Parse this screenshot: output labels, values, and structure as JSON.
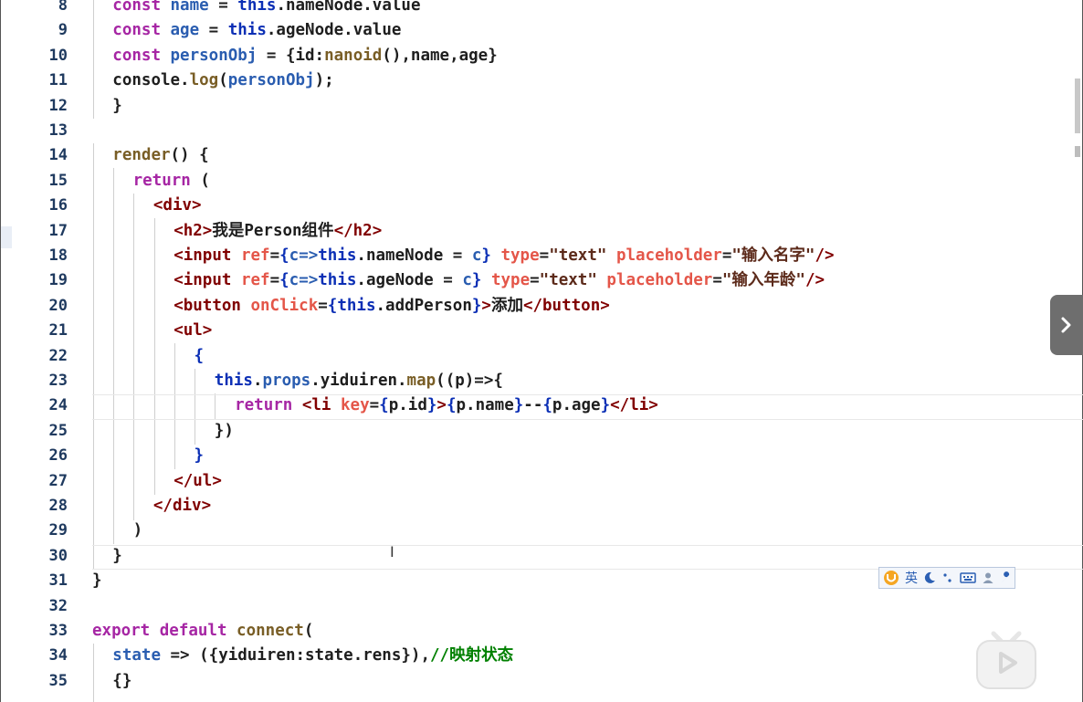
{
  "editor": {
    "lines": [
      {
        "num": "8",
        "tokens": [
          {
            "t": "const ",
            "c": "t-kw"
          },
          {
            "t": "name",
            "c": "t-var"
          },
          {
            "t": " = ",
            "c": "t-plain"
          },
          {
            "t": "this",
            "c": "t-this"
          },
          {
            "t": ".nameNode.value",
            "c": "t-plain"
          }
        ]
      },
      {
        "num": "9",
        "tokens": [
          {
            "t": "const ",
            "c": "t-kw"
          },
          {
            "t": "age",
            "c": "t-var"
          },
          {
            "t": " = ",
            "c": "t-plain"
          },
          {
            "t": "this",
            "c": "t-this"
          },
          {
            "t": ".ageNode.value",
            "c": "t-plain"
          }
        ]
      },
      {
        "num": "10",
        "tokens": [
          {
            "t": "const ",
            "c": "t-kw"
          },
          {
            "t": "personObj",
            "c": "t-var"
          },
          {
            "t": " = {id:",
            "c": "t-plain"
          },
          {
            "t": "nanoid",
            "c": "t-fn"
          },
          {
            "t": "(),name,age}",
            "c": "t-plain"
          }
        ]
      },
      {
        "num": "11",
        "tokens": [
          {
            "t": "console.",
            "c": "t-plain"
          },
          {
            "t": "log",
            "c": "t-fn"
          },
          {
            "t": "(",
            "c": "t-plain"
          },
          {
            "t": "personObj",
            "c": "t-var"
          },
          {
            "t": ");",
            "c": "t-plain"
          }
        ]
      },
      {
        "num": "12",
        "tokens": [
          {
            "t": "}",
            "c": "t-plain"
          }
        ]
      },
      {
        "num": "13",
        "tokens": []
      },
      {
        "num": "14",
        "tokens": [
          {
            "t": "render",
            "c": "t-fn"
          },
          {
            "t": "() {",
            "c": "t-plain"
          }
        ]
      },
      {
        "num": "15",
        "tokens": [
          {
            "t": "return",
            "c": "t-ctl"
          },
          {
            "t": " (",
            "c": "t-plain"
          }
        ]
      },
      {
        "num": "16",
        "tokens": [
          {
            "t": "<div>",
            "c": "t-tag"
          }
        ]
      },
      {
        "num": "17",
        "tokens": [
          {
            "t": "<h2>",
            "c": "t-tag"
          },
          {
            "t": "我是Person组件",
            "c": "t-text"
          },
          {
            "t": "</h2>",
            "c": "t-tag"
          }
        ]
      },
      {
        "num": "18",
        "tokens": [
          {
            "t": "<input ",
            "c": "t-tag"
          },
          {
            "t": "ref",
            "c": "t-attr"
          },
          {
            "t": "=",
            "c": "t-plain"
          },
          {
            "t": "{",
            "c": "t-brace"
          },
          {
            "t": "c=>",
            "c": "t-var"
          },
          {
            "t": "this",
            "c": "t-this"
          },
          {
            "t": ".nameNode = ",
            "c": "t-plain"
          },
          {
            "t": "c",
            "c": "t-var"
          },
          {
            "t": "}",
            "c": "t-brace"
          },
          {
            "t": " type",
            "c": "t-attr"
          },
          {
            "t": "=",
            "c": "t-plain"
          },
          {
            "t": "\"text\"",
            "c": "t-str2"
          },
          {
            "t": " placeholder",
            "c": "t-attr"
          },
          {
            "t": "=",
            "c": "t-plain"
          },
          {
            "t": "\"输入名字\"",
            "c": "t-str2"
          },
          {
            "t": "/>",
            "c": "t-tag"
          }
        ]
      },
      {
        "num": "19",
        "tokens": [
          {
            "t": "<input ",
            "c": "t-tag"
          },
          {
            "t": "ref",
            "c": "t-attr"
          },
          {
            "t": "=",
            "c": "t-plain"
          },
          {
            "t": "{",
            "c": "t-brace"
          },
          {
            "t": "c=>",
            "c": "t-var"
          },
          {
            "t": "this",
            "c": "t-this"
          },
          {
            "t": ".ageNode = ",
            "c": "t-plain"
          },
          {
            "t": "c",
            "c": "t-var"
          },
          {
            "t": "}",
            "c": "t-brace"
          },
          {
            "t": " type",
            "c": "t-attr"
          },
          {
            "t": "=",
            "c": "t-plain"
          },
          {
            "t": "\"text\"",
            "c": "t-str2"
          },
          {
            "t": " placeholder",
            "c": "t-attr"
          },
          {
            "t": "=",
            "c": "t-plain"
          },
          {
            "t": "\"输入年龄\"",
            "c": "t-str2"
          },
          {
            "t": "/>",
            "c": "t-tag"
          }
        ]
      },
      {
        "num": "20",
        "tokens": [
          {
            "t": "<button ",
            "c": "t-tag"
          },
          {
            "t": "onClick",
            "c": "t-attr"
          },
          {
            "t": "=",
            "c": "t-plain"
          },
          {
            "t": "{",
            "c": "t-brace"
          },
          {
            "t": "this",
            "c": "t-this"
          },
          {
            "t": ".addPerson",
            "c": "t-plain"
          },
          {
            "t": "}",
            "c": "t-brace"
          },
          {
            "t": ">",
            "c": "t-tag"
          },
          {
            "t": "添加",
            "c": "t-text"
          },
          {
            "t": "</button>",
            "c": "t-tag"
          }
        ]
      },
      {
        "num": "21",
        "tokens": [
          {
            "t": "<ul>",
            "c": "t-tag"
          }
        ]
      },
      {
        "num": "22",
        "tokens": [
          {
            "t": "{",
            "c": "t-brace"
          }
        ]
      },
      {
        "num": "23",
        "tokens": [
          {
            "t": "this",
            "c": "t-this"
          },
          {
            "t": ".",
            "c": "t-plain"
          },
          {
            "t": "props",
            "c": "t-var"
          },
          {
            "t": ".yiduiren.",
            "c": "t-plain"
          },
          {
            "t": "map",
            "c": "t-fn"
          },
          {
            "t": "((p)=>{",
            "c": "t-plain"
          }
        ]
      },
      {
        "num": "24",
        "tokens": [
          {
            "t": "return ",
            "c": "t-ctl"
          },
          {
            "t": "<li ",
            "c": "t-tag"
          },
          {
            "t": "key",
            "c": "t-attr"
          },
          {
            "t": "=",
            "c": "t-plain"
          },
          {
            "t": "{",
            "c": "t-brace"
          },
          {
            "t": "p.id",
            "c": "t-plain"
          },
          {
            "t": "}",
            "c": "t-brace"
          },
          {
            "t": ">",
            "c": "t-tag"
          },
          {
            "t": "{",
            "c": "t-brace"
          },
          {
            "t": "p.name",
            "c": "t-plain"
          },
          {
            "t": "}",
            "c": "t-brace"
          },
          {
            "t": "--",
            "c": "t-text"
          },
          {
            "t": "{",
            "c": "t-brace"
          },
          {
            "t": "p.age",
            "c": "t-plain"
          },
          {
            "t": "}",
            "c": "t-brace"
          },
          {
            "t": "</li>",
            "c": "t-tag"
          }
        ]
      },
      {
        "num": "25",
        "tokens": [
          {
            "t": "})",
            "c": "t-plain"
          }
        ]
      },
      {
        "num": "26",
        "tokens": [
          {
            "t": "}",
            "c": "t-brace"
          }
        ]
      },
      {
        "num": "27",
        "tokens": [
          {
            "t": "</ul>",
            "c": "t-tag"
          }
        ]
      },
      {
        "num": "28",
        "tokens": [
          {
            "t": "</div>",
            "c": "t-tag"
          }
        ]
      },
      {
        "num": "29",
        "tokens": [
          {
            "t": ")",
            "c": "t-plain"
          }
        ]
      },
      {
        "num": "30",
        "tokens": [
          {
            "t": "}",
            "c": "t-plain"
          }
        ]
      },
      {
        "num": "31",
        "tokens": [
          {
            "t": "}",
            "c": "t-plain"
          }
        ]
      },
      {
        "num": "32",
        "tokens": []
      },
      {
        "num": "33",
        "tokens": [
          {
            "t": "export default ",
            "c": "t-ctl"
          },
          {
            "t": "connect",
            "c": "t-fn"
          },
          {
            "t": "(",
            "c": "t-plain"
          }
        ]
      },
      {
        "num": "34",
        "tokens": [
          {
            "t": "state",
            "c": "t-var"
          },
          {
            "t": " => ({yiduiren:state.rens}),",
            "c": "t-plain"
          },
          {
            "t": "//映射状态",
            "c": "t-cmt"
          }
        ]
      },
      {
        "num": "35",
        "tokens": [
          {
            "t": "{}",
            "c": "t-plain"
          }
        ]
      }
    ]
  },
  "ime_toolbar": {
    "lang_label": "英",
    "icons": [
      "sogou-logo-icon",
      "moon-icon",
      "punctuation-icon",
      "keyboard-icon",
      "user-icon",
      "wrench-icon"
    ]
  },
  "overlay": {
    "collapse_icon": "chevron-right-icon",
    "watermark_icon": "video-play-icon"
  }
}
